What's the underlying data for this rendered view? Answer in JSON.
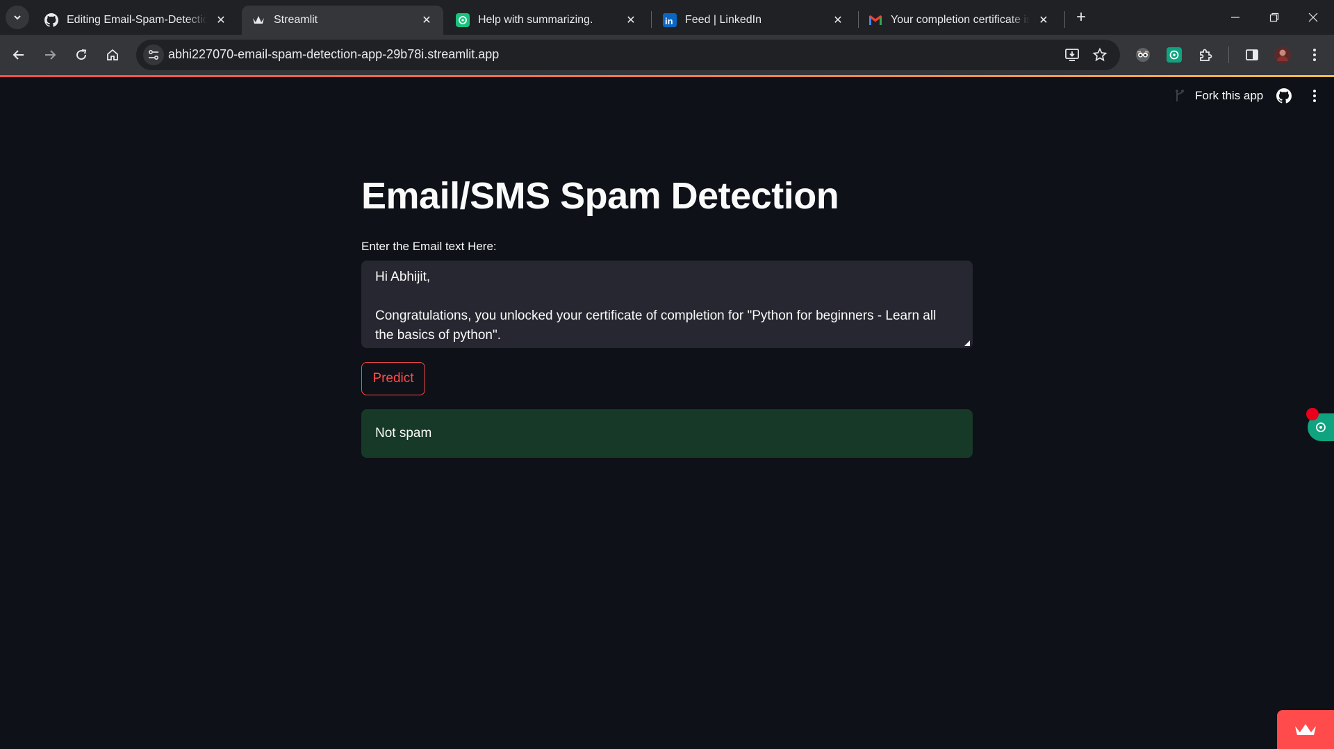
{
  "browser": {
    "tabs": [
      {
        "title": "Editing Email-Spam-Detection/REA",
        "icon": "github-icon",
        "active": false
      },
      {
        "title": "Streamlit",
        "icon": "streamlit-icon",
        "active": true
      },
      {
        "title": "Help with summarizing.",
        "icon": "chatgpt-icon",
        "active": false
      },
      {
        "title": "Feed | LinkedIn",
        "icon": "linkedin-icon",
        "active": false
      },
      {
        "title": "Your completion certificate is ready",
        "icon": "gmail-icon",
        "active": false
      }
    ],
    "url": "abhi227070-email-spam-detection-app-29b78i.streamlit.app"
  },
  "app": {
    "header": {
      "fork_label": "Fork this app"
    },
    "title": "Email/SMS Spam Detection",
    "input": {
      "label": "Enter the Email text Here:",
      "lines": [
        "Hi Abhijit,",
        "",
        "Congratulations, you unlocked your certificate of completion for \"Python for beginners - Learn all",
        "the basics of python\"."
      ]
    },
    "predict_label": "Predict",
    "result_text": "Not spam"
  },
  "colors": {
    "background": "#0e1117",
    "primary": "#ff4b4b",
    "success_bg": "#173928",
    "input_bg": "#262730",
    "text": "#fafafa"
  }
}
